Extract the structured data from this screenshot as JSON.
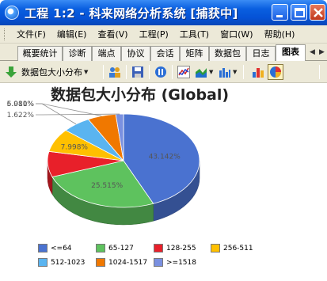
{
  "window": {
    "title": "工程 1:2 - 科来网络分析系统 [捕获中]"
  },
  "menubar": {
    "items": [
      "文件(F)",
      "编辑(E)",
      "查看(V)",
      "工程(P)",
      "工具(T)",
      "窗口(W)",
      "帮助(H)"
    ]
  },
  "tabs": {
    "items": [
      "概要统计",
      "诊断",
      "端点",
      "协议",
      "会话",
      "矩阵",
      "数据包",
      "日志",
      "图表"
    ],
    "active": "图表"
  },
  "toolbar": {
    "dropdown_label": "数据包大小分布"
  },
  "chart_data": {
    "type": "pie",
    "title": "数据包大小分布 (Global)",
    "categories": [
      "<=64",
      "65-127",
      "128-255",
      "256-511",
      "512-1023",
      "1024-1517",
      ">=1518"
    ],
    "values": [
      43.142,
      25.515,
      8.726,
      7.998,
      6.01,
      5.981,
      1.622
    ],
    "value_labels": [
      "43.142%",
      "25.515%",
      "",
      "7.998%",
      "6.010%",
      "5.981%",
      "1.622%"
    ],
    "colors": [
      "#4a72d0",
      "#5ec25e",
      "#e8202a",
      "#ffc000",
      "#5ab4f0",
      "#f07800",
      "#7a90e0"
    ],
    "legend_position": "bottom"
  }
}
